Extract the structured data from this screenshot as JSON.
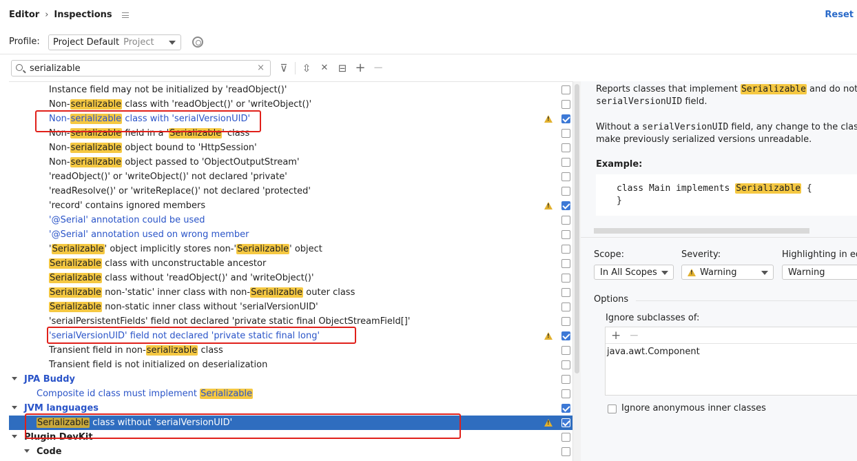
{
  "header": {
    "breadcrumb_parent": "Editor",
    "breadcrumb_sep": "›",
    "breadcrumb_current": "Inspections",
    "reset_label": "Reset"
  },
  "profile": {
    "label": "Profile:",
    "value": "Project Default",
    "sub": "Project"
  },
  "search": {
    "value": "serializable",
    "clear_glyph": "×"
  },
  "toolbar": {
    "filter": "⊽",
    "expand": "⇳",
    "collapse": "✕",
    "reset_to_default": "⊟",
    "add": "+",
    "remove": "−"
  },
  "tree_rows": [
    {
      "parts": [
        {
          "t": "Instance field may not be initialized by 'readObject()'"
        }
      ],
      "style": "normal",
      "indent": 58,
      "checked": false,
      "warn": false
    },
    {
      "parts": [
        {
          "t": "Non-"
        },
        {
          "t": "serializable",
          "h": true
        },
        {
          "t": " class with 'readObject()' or 'writeObject()'"
        }
      ],
      "style": "normal",
      "indent": 58,
      "checked": false,
      "warn": false
    },
    {
      "parts": [
        {
          "t": "Non-"
        },
        {
          "t": "serializable",
          "h": true
        },
        {
          "t": " class with 'serialVersionUID'"
        }
      ],
      "style": "blue",
      "indent": 58,
      "checked": true,
      "warn": true
    },
    {
      "parts": [
        {
          "t": "Non-"
        },
        {
          "t": "serializable",
          "h": true
        },
        {
          "t": " field in a '"
        },
        {
          "t": "Serializable",
          "h": true
        },
        {
          "t": "' class"
        }
      ],
      "style": "normal",
      "indent": 58,
      "checked": false,
      "warn": false
    },
    {
      "parts": [
        {
          "t": "Non-"
        },
        {
          "t": "serializable",
          "h": true
        },
        {
          "t": " object bound to 'HttpSession'"
        }
      ],
      "style": "normal",
      "indent": 58,
      "checked": false,
      "warn": false
    },
    {
      "parts": [
        {
          "t": "Non-"
        },
        {
          "t": "serializable",
          "h": true
        },
        {
          "t": " object passed to 'ObjectOutputStream'"
        }
      ],
      "style": "normal",
      "indent": 58,
      "checked": false,
      "warn": false
    },
    {
      "parts": [
        {
          "t": "'readObject()' or 'writeObject()' not declared 'private'"
        }
      ],
      "style": "normal",
      "indent": 58,
      "checked": false,
      "warn": false
    },
    {
      "parts": [
        {
          "t": "'readResolve()' or 'writeReplace()' not declared 'protected'"
        }
      ],
      "style": "normal",
      "indent": 58,
      "checked": false,
      "warn": false
    },
    {
      "parts": [
        {
          "t": "'record' contains ignored members"
        }
      ],
      "style": "normal",
      "indent": 58,
      "checked": true,
      "warn": true
    },
    {
      "parts": [
        {
          "t": "'@Serial' annotation could be used"
        }
      ],
      "style": "blue",
      "indent": 58,
      "checked": false,
      "warn": false
    },
    {
      "parts": [
        {
          "t": "'@Serial' annotation used on wrong member"
        }
      ],
      "style": "blue",
      "indent": 58,
      "checked": false,
      "warn": false
    },
    {
      "parts": [
        {
          "t": "'"
        },
        {
          "t": "Serializable",
          "h": true
        },
        {
          "t": "' object implicitly stores non-'"
        },
        {
          "t": "Serializable",
          "h": true
        },
        {
          "t": "' object"
        }
      ],
      "style": "normal",
      "indent": 58,
      "checked": false,
      "warn": false
    },
    {
      "parts": [
        {
          "t": "Serializable",
          "h": true
        },
        {
          "t": " class with unconstructable ancestor"
        }
      ],
      "style": "normal",
      "indent": 58,
      "checked": false,
      "warn": false
    },
    {
      "parts": [
        {
          "t": "Serializable",
          "h": true
        },
        {
          "t": " class without 'readObject()' and 'writeObject()'"
        }
      ],
      "style": "normal",
      "indent": 58,
      "checked": false,
      "warn": false
    },
    {
      "parts": [
        {
          "t": "Serializable",
          "h": true
        },
        {
          "t": " non-'static' inner class with non-"
        },
        {
          "t": "Serializable",
          "h": true
        },
        {
          "t": " outer class"
        }
      ],
      "style": "normal",
      "indent": 58,
      "checked": false,
      "warn": false
    },
    {
      "parts": [
        {
          "t": "Serializable",
          "h": true
        },
        {
          "t": " non-static inner class without 'serialVersionUID'"
        }
      ],
      "style": "normal",
      "indent": 58,
      "checked": false,
      "warn": false
    },
    {
      "parts": [
        {
          "t": "'serialPersistentFields' field not declared 'private static final ObjectStreamField[]'"
        }
      ],
      "style": "normal",
      "indent": 58,
      "checked": false,
      "warn": false
    },
    {
      "parts": [
        {
          "t": "'serialVersionUID' field not declared 'private static final long'"
        }
      ],
      "style": "blue",
      "indent": 58,
      "checked": true,
      "warn": true
    },
    {
      "parts": [
        {
          "t": "Transient field in non-"
        },
        {
          "t": "serializable",
          "h": true
        },
        {
          "t": " class"
        }
      ],
      "style": "normal",
      "indent": 58,
      "checked": false,
      "warn": false
    },
    {
      "parts": [
        {
          "t": "Transient field is not initialized on deserialization"
        }
      ],
      "style": "normal",
      "indent": 58,
      "checked": false,
      "warn": false
    },
    {
      "parts": [
        {
          "t": "JPA Buddy"
        }
      ],
      "style": "group",
      "indent": 22,
      "checked": false,
      "warn": false,
      "chev": 4
    },
    {
      "parts": [
        {
          "t": "Composite id class must implement "
        },
        {
          "t": "Serializable",
          "h": true
        }
      ],
      "style": "blue",
      "indent": 40,
      "checked": false,
      "warn": false
    },
    {
      "parts": [
        {
          "t": "JVM languages"
        }
      ],
      "style": "group",
      "indent": 22,
      "checked": true,
      "warn": false,
      "chev": 4
    },
    {
      "parts": [
        {
          "t": "Serializable",
          "h": true
        },
        {
          "t": " class without 'serialVersionUID'"
        }
      ],
      "style": "selected",
      "indent": 40,
      "checked": true,
      "warn": true
    },
    {
      "parts": [
        {
          "t": "Plugin DevKit"
        }
      ],
      "style": "groupdark",
      "indent": 22,
      "checked": false,
      "warn": false,
      "chev": 4
    },
    {
      "parts": [
        {
          "t": "Code"
        }
      ],
      "style": "groupdark",
      "indent": 40,
      "checked": false,
      "warn": false,
      "chev": 22
    }
  ],
  "description": {
    "line1_a": "Reports classes that implement ",
    "line1_hl": "Serializable",
    "line1_b": " and do not d",
    "line2_mono": "serialVersionUID",
    "line2_b": " field.",
    "line3_a": "Without a ",
    "line3_mono": "serialVersionUID",
    "line3_b": " field, any change to the class",
    "line4": "make previously serialized versions unreadable.",
    "example_label": "Example:",
    "code_1a": "class Main implements ",
    "code_1hl": "Serializable",
    "code_1b": " {",
    "code_2": "}"
  },
  "settings": {
    "scope_label": "Scope:",
    "scope_value": "In All Scopes",
    "severity_label": "Severity:",
    "severity_value": "Warning",
    "highlight_label": "Highlighting in ed",
    "highlight_value": "Warning",
    "options_label": "Options",
    "ignore_subclasses_label": "Ignore subclasses of:",
    "list_add": "+",
    "list_remove": "−",
    "list_item": "java.awt.Component",
    "ignore_anonymous_label": "Ignore anonymous inner classes"
  },
  "colors": {
    "accent": "#2f6dbf",
    "highlight": "#f5c842",
    "link_blue": "#2a54c8",
    "annotation_red": "#e0201a",
    "warning": "#e2b12f"
  }
}
